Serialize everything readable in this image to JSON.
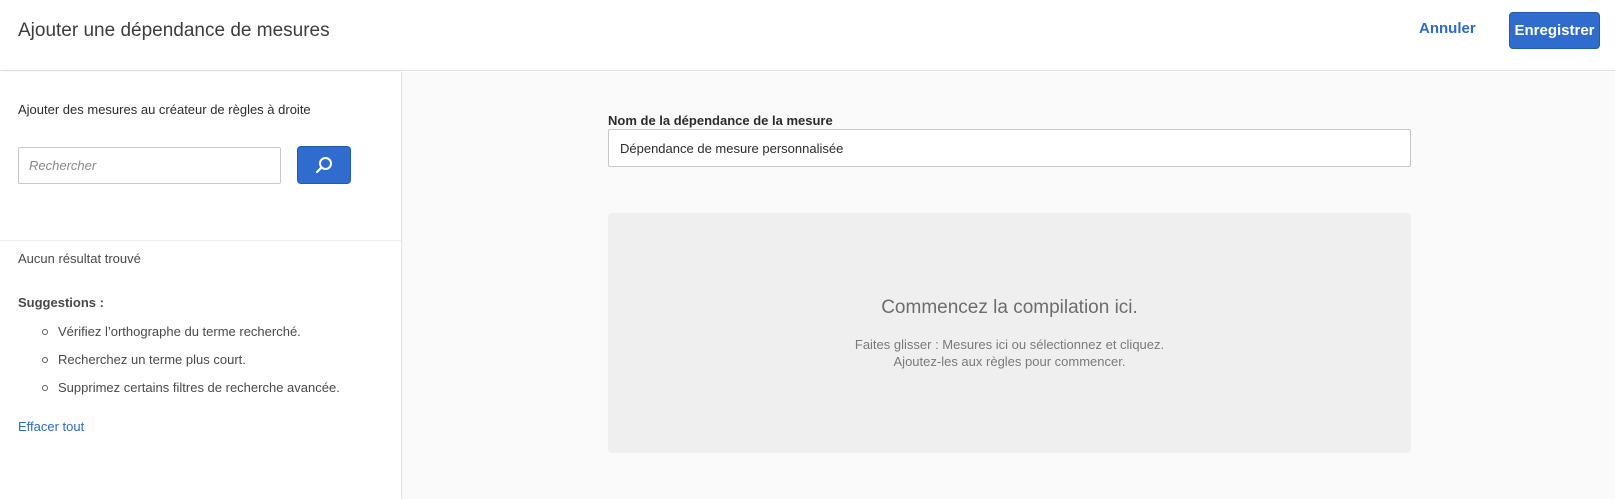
{
  "header": {
    "title": "Ajouter une dépendance de mesures",
    "cancel_label": "Annuler",
    "save_label": "Enregistrer"
  },
  "sidebar": {
    "heading": "Ajouter des mesures au créateur de règles à droite",
    "search": {
      "placeholder": "Rechercher",
      "value": "",
      "button_icon": "search-icon"
    },
    "no_results": "Aucun résultat trouvé",
    "suggestions_title": "Suggestions :",
    "suggestions": [
      "Vérifiez l’orthographe du terme recherché.",
      "Recherchez un terme plus court.",
      "Supprimez certains filtres de recherche avancée."
    ],
    "clear_all": "Effacer tout"
  },
  "main": {
    "name_label": "Nom de la dépendance de la mesure",
    "name_value": "Dépendance de mesure personnalisée",
    "drop_zone": {
      "title": "Commencez la compilation ici.",
      "line1": "Faites glisser : Mesures ici ou sélectionnez et cliquez.",
      "line2": "Ajoutez-les aux règles pour commencer."
    }
  },
  "colors": {
    "accent": "#2f6cce",
    "link": "#2d6ac9",
    "drop_zone_bg": "#efefef"
  }
}
